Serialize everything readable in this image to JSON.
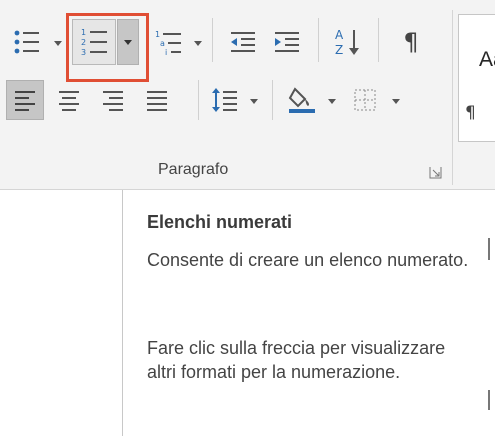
{
  "ribbon": {
    "group_label": "Paragrafo",
    "styles_sample": "Aa",
    "styles_mark": "¶"
  },
  "tools": {
    "sort_glyph": "A Z",
    "show_marks": "¶"
  },
  "tooltip": {
    "title": "Elenchi numerati",
    "description": "Consente di creare un elenco numerato.",
    "hint": "Fare clic sulla freccia per visualizzare altri formati per la numerazione."
  },
  "colors": {
    "highlight": "#e04e34",
    "icon_blue": "#2b6cb0",
    "selected_bg": "#c6c6c6"
  }
}
